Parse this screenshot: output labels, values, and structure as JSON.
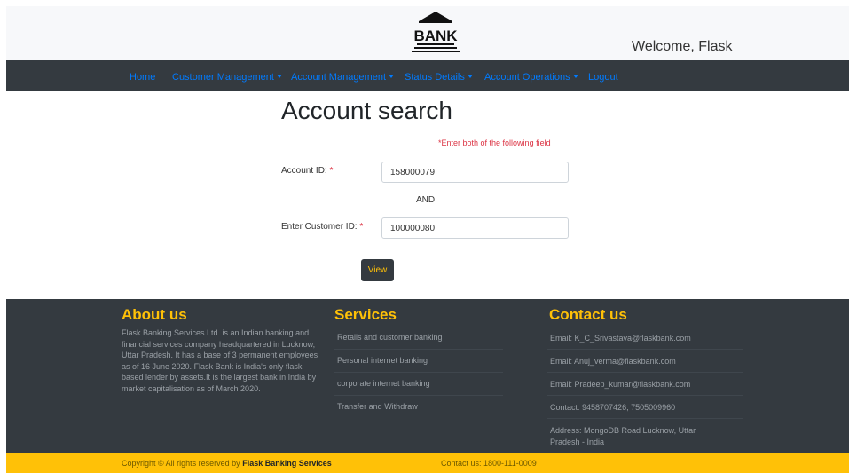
{
  "header": {
    "logo_text": "BANK",
    "welcome": "Welcome, Flask"
  },
  "nav": {
    "items": [
      {
        "label": "Home",
        "dropdown": false
      },
      {
        "label": "Customer Management",
        "dropdown": true
      },
      {
        "label": "Account Management",
        "dropdown": true
      },
      {
        "label": "Status Details",
        "dropdown": true
      },
      {
        "label": "Account Operations",
        "dropdown": true
      },
      {
        "label": "Logout",
        "dropdown": false
      }
    ]
  },
  "form": {
    "title": "Account search",
    "required_note": "*Enter both of the following field",
    "account_id": {
      "label": "Account ID:",
      "required": "*",
      "value": "158000079"
    },
    "and_text": "AND",
    "customer_id": {
      "label": "Enter Customer ID:",
      "required": "*",
      "value": "100000080"
    },
    "view_button": "View"
  },
  "footer": {
    "about": {
      "heading": "About us",
      "text": "Flask Banking Services Ltd. is an Indian banking and financial services company headquartered in Lucknow, Uttar Pradesh. It has a base of 3 permanent employees as of 16 June 2020. Flask Bank is India's only flask based lender by assets.It is the largest bank in India by market capitalisation as of March 2020."
    },
    "services": {
      "heading": "Services",
      "items": [
        "Retails and customer banking",
        "Personal internet banking",
        "corporate internet banking",
        "Transfer and Withdraw"
      ]
    },
    "contact": {
      "heading": "Contact us",
      "items": [
        "Email: K_C_Srivastava@flaskbank.com",
        "Email: Anuj_verma@flaskbank.com",
        "Email: Pradeep_kumar@flaskbank.com",
        "Contact: 9458707426, 7505009960",
        "Address: MongoDB Road Lucknow, Uttar Pradesh - India"
      ]
    }
  },
  "bottom_bar": {
    "copyright_prefix": "Copyright © All rights reserved by",
    "company": "Flask Banking Services",
    "contact": "Contact us: 1800-111-0009"
  },
  "colors": {
    "dark": "#343a40",
    "accent": "#ffc107",
    "link": "#007bff",
    "required": "#dc3545"
  }
}
